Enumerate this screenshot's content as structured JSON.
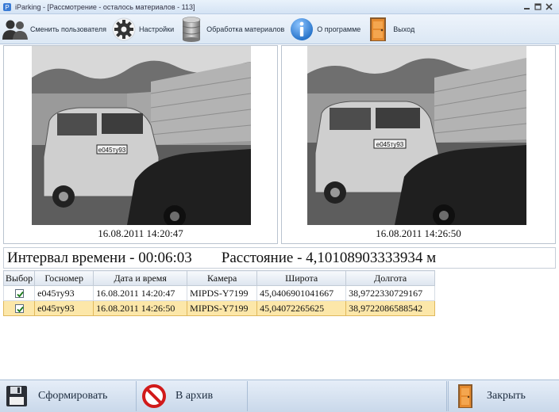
{
  "window": {
    "title": "iParking - [Рассмотрение - осталось материалов - 113]"
  },
  "toolbar": {
    "items": [
      {
        "label": "Сменить пользователя",
        "icon": "users-icon"
      },
      {
        "label": "Настройки",
        "icon": "gear-icon"
      },
      {
        "label": "Обработка материалов",
        "icon": "database-icon"
      },
      {
        "label": "О программе",
        "icon": "info-icon"
      },
      {
        "label": "Выход",
        "icon": "exit-door-icon"
      }
    ]
  },
  "photos": {
    "left": {
      "timestamp": "16.08.2011 14:20:47",
      "plate": "е045ту93"
    },
    "right": {
      "timestamp": "16.08.2011 14:26:50",
      "plate": "е045ту93"
    }
  },
  "summary": {
    "interval": "Интервал времени - 00:06:03",
    "distance": "Расстояние - 4,10108903333934 м"
  },
  "table": {
    "columns": [
      "Выбор",
      "Госномер",
      "Дата и время",
      "Камера",
      "Широта",
      "Долгота"
    ],
    "rows": [
      {
        "checked": true,
        "plate": "е045ту93",
        "datetime": "16.08.2011 14:20:47",
        "camera": "MIPDS-Y7199",
        "lat": "45,0406901041667",
        "lon": "38,9722330729167",
        "selected": false
      },
      {
        "checked": true,
        "plate": "е045ту93",
        "datetime": "16.08.2011 14:26:50",
        "camera": "MIPDS-Y7199",
        "lat": "45,04072265625",
        "lon": "38,9722086588542",
        "selected": true
      }
    ]
  },
  "bottom": {
    "form_label": "Сформировать",
    "archive_label": "В архив",
    "close_label": "Закрыть"
  },
  "colors": {
    "selected_row": "#fce7a9",
    "toolbar_bg": "#dbe7f4"
  }
}
